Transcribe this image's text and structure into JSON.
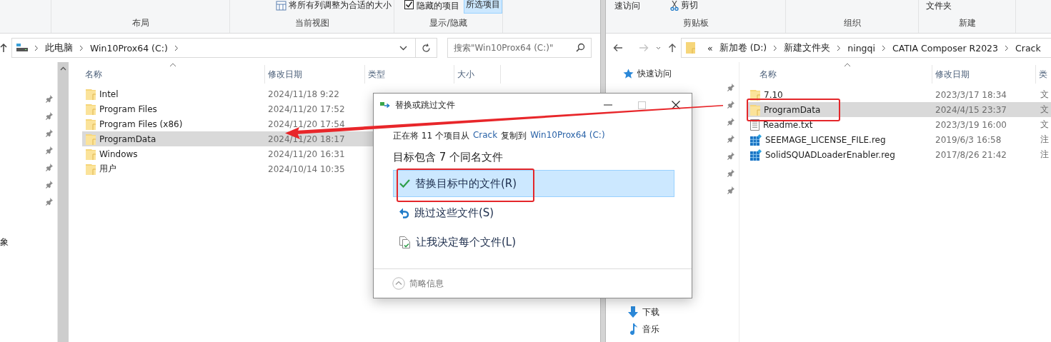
{
  "left_window": {
    "ribbon": {
      "layout": {
        "label": "布局"
      },
      "current_view": {
        "label": "当前视图",
        "fit_columns": "将所有列调整为合适的大小"
      },
      "show_hide": {
        "label": "显示/隐藏",
        "hidden_items": {
          "label": "隐藏的项目",
          "checked": true
        },
        "selected_items": {
          "label": "所选项目",
          "on": true
        }
      }
    },
    "address": {
      "crumbs": [
        "此电脑",
        "Win10Prox64 (C:)"
      ]
    },
    "search": {
      "placeholder": "搜索\"Win10Prox64 (C:)\""
    },
    "nav_pane": {
      "items": [
        "象"
      ]
    },
    "columns": [
      "名称",
      "修改日期",
      "类型",
      "大小"
    ],
    "rows": [
      {
        "name": "Intel",
        "modified": "2024/11/18 9:22",
        "selected": false
      },
      {
        "name": "Program Files",
        "modified": "2024/11/20 17:52",
        "selected": false
      },
      {
        "name": "Program Files (x86)",
        "modified": "2024/11/20 17:54",
        "selected": false
      },
      {
        "name": "ProgramData",
        "modified": "2024/11/20 18:17",
        "selected": true
      },
      {
        "name": "Windows",
        "modified": "2024/11/20 16:31",
        "selected": false
      },
      {
        "name": "用户",
        "modified": "2024/10/14 10:35",
        "selected": false
      }
    ]
  },
  "right_window": {
    "ribbon": {
      "clipboard": {
        "label": "剪贴板",
        "quick_access": "速访问",
        "cut": "剪切"
      },
      "organize": {
        "label": "组织"
      },
      "new": {
        "label": "新建",
        "folder": "文件夹"
      }
    },
    "address": {
      "overflow": "«",
      "crumbs": [
        "新加卷 (D:)",
        "新建文件夹",
        "ningqi",
        "CATIA Composer R2023",
        "Crack"
      ]
    },
    "nav_pane": {
      "items": [
        {
          "label": "快速访问",
          "kind": "star"
        },
        {
          "label": "下载",
          "kind": "download"
        },
        {
          "label": "音乐",
          "kind": "music"
        }
      ]
    },
    "columns": [
      "名称",
      "修改日期",
      "类"
    ],
    "rows": [
      {
        "name": "7.10",
        "modified": "2023/3/17 18:34",
        "type": "文",
        "kind": "folder",
        "selected": false
      },
      {
        "name": "ProgramData",
        "modified": "2024/4/15 23:37",
        "type": "文",
        "kind": "folder",
        "selected": true
      },
      {
        "name": "Readme.txt",
        "modified": "2023/3/19 16:00",
        "type": "文",
        "kind": "text",
        "selected": false
      },
      {
        "name": "SEEMAGE_LICENSE_FILE.reg",
        "modified": "2019/6/3 16:58",
        "type": "注",
        "kind": "registry",
        "selected": false
      },
      {
        "name": "SolidSQUADLoaderEnabler.reg",
        "modified": "2017/8/26 21:42",
        "type": "注",
        "kind": "registry",
        "selected": false
      }
    ]
  },
  "dialog": {
    "title": "替换或跳过文件",
    "message": {
      "prefix": "正在将 11 个项目从",
      "source": "Crack",
      "middle": "复制到",
      "target": "Win10Prox64 (C:)"
    },
    "heading": "目标包含 7 个同名文件",
    "options": [
      {
        "label": "替换目标中的文件(R)",
        "kind": "replace",
        "selected": true
      },
      {
        "label": "跳过这些文件(S)",
        "kind": "skip",
        "selected": false
      },
      {
        "label": "让我决定每个文件(L)",
        "kind": "decide",
        "selected": false
      }
    ],
    "details": "简略信息"
  }
}
